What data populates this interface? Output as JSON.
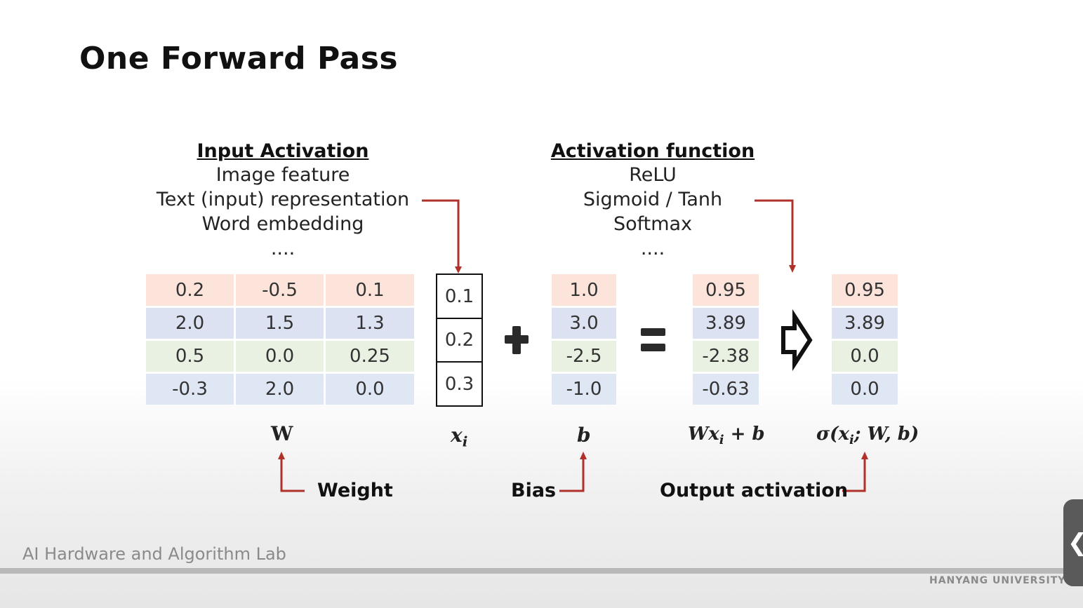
{
  "slide": {
    "title": "One Forward Pass",
    "input_heading": "Input Activation",
    "input_lines": [
      "Image feature",
      "Text (input) representation",
      "Word embedding",
      "...."
    ],
    "act_heading": "Activation function",
    "act_lines": [
      "ReLU",
      "Sigmoid / Tanh",
      "Softmax",
      "...."
    ],
    "weights": [
      [
        "0.2",
        "-0.5",
        "0.1"
      ],
      [
        "2.0",
        "1.5",
        "1.3"
      ],
      [
        "0.5",
        "0.0",
        "0.25"
      ],
      [
        "-0.3",
        "2.0",
        "0.0"
      ]
    ],
    "x": [
      "0.1",
      "0.2",
      "0.3"
    ],
    "bias": [
      "1.0",
      "3.0",
      "-2.5",
      "-1.0"
    ],
    "wxb": [
      "0.95",
      "3.89",
      "-2.38",
      "-0.63"
    ],
    "out": [
      "0.95",
      "3.89",
      "0.0",
      "0.0"
    ],
    "labels": {
      "W": "W",
      "x_base": "x",
      "x_sub": "i",
      "b": "b",
      "wxb_pre": "Wx",
      "wxb_sub": "i",
      "wxb_post": " + b",
      "sigma_pre": "σ(x",
      "sigma_sub": "i",
      "sigma_post": "; W, b)"
    },
    "captions": {
      "weight": "Weight",
      "bias": "Bias",
      "output": "Output activation"
    },
    "footer_lab": "AI Hardware and Algorithm Lab",
    "footer_uni": "HANYANG UNIVERSITY",
    "colors": {
      "arrow": "#b0302a",
      "row0": "#fde4da",
      "row1": "#dde2f3",
      "row2": "#e9f1e3",
      "row3": "#dfe7f4"
    }
  }
}
